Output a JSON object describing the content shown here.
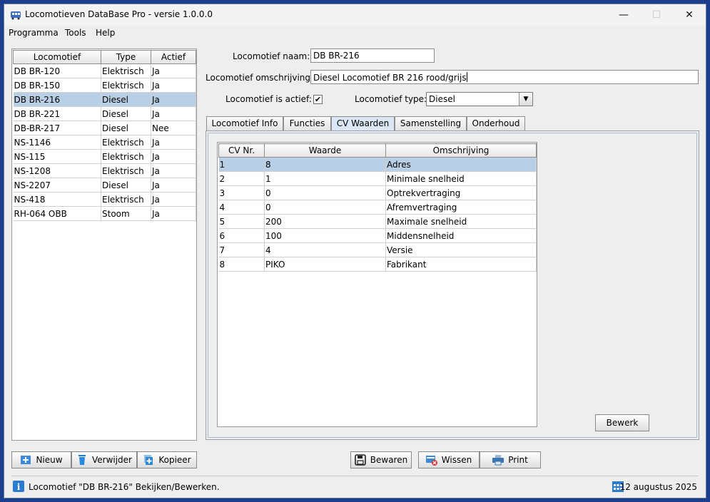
{
  "window": {
    "title": "Locomotieven DataBase Pro - versie 1.0.0.0",
    "minimize_glyph": "—",
    "maximize_glyph": "☐",
    "close_glyph": "✕"
  },
  "menu": [
    "Programma",
    "Tools",
    "Help"
  ],
  "loco_list": {
    "headers": [
      "Locomotief",
      "Type",
      "Actief"
    ],
    "rows": [
      [
        "DB BR-120",
        "Elektrisch",
        "Ja"
      ],
      [
        "DB BR-150",
        "Elektrisch",
        "Ja"
      ],
      [
        "DB BR-216",
        "Diesel",
        "Ja"
      ],
      [
        "DB BR-221",
        "Diesel",
        "Ja"
      ],
      [
        "DB-BR-217",
        "Diesel",
        "Nee"
      ],
      [
        "NS-1146",
        "Elektrisch",
        "Ja"
      ],
      [
        "NS-115",
        "Elektrisch",
        "Ja"
      ],
      [
        "NS-1208",
        "Elektrisch",
        "Ja"
      ],
      [
        "NS-2207",
        "Diesel",
        "Ja"
      ],
      [
        "NS-418",
        "Elektrisch",
        "Ja"
      ],
      [
        "RH-064 OBB",
        "Stoom",
        "Ja"
      ]
    ],
    "selected_index": 2
  },
  "form": {
    "naam_label": "Locomotief naam:",
    "naam_value": "DB BR-216",
    "omschrijving_label": "Locomotief omschrijving:",
    "omschrijving_value": "Diesel Locomotief BR 216 rood/grijs",
    "actief_label": "Locomotief is actief:",
    "actief_checked": true,
    "actief_mark": "✔",
    "type_label": "Locomotief type:",
    "type_value": "Diesel",
    "type_arrow": "▼"
  },
  "tabs": [
    "Locomotief Info",
    "Functies",
    "CV Waarden",
    "Samenstelling",
    "Onderhoud"
  ],
  "active_tab": 2,
  "cv_table": {
    "headers": [
      "CV Nr.",
      "Waarde",
      "Omschrijving"
    ],
    "rows": [
      [
        "1",
        "8",
        "Adres"
      ],
      [
        "2",
        "1",
        "Minimale snelheid"
      ],
      [
        "3",
        "0",
        "Optrekvertraging"
      ],
      [
        "4",
        "0",
        "Afremvertraging"
      ],
      [
        "5",
        "200",
        "Maximale snelheid"
      ],
      [
        "6",
        "100",
        "Middensnelheid"
      ],
      [
        "7",
        "4",
        "Versie"
      ],
      [
        "8",
        "PIKO",
        "Fabrikant"
      ]
    ],
    "selected_index": 0
  },
  "buttons": {
    "bewerk": "Bewerk",
    "nieuw": "Nieuw",
    "verwijder": "Verwijder",
    "kopieer": "Kopieer",
    "bewaren": "Bewaren",
    "wissen": "Wissen",
    "print": "Print"
  },
  "status": {
    "info_glyph": "i",
    "message": "Locomotief \"DB BR-216\" Bekijken/Bewerken.",
    "date": "12 augustus 2025"
  },
  "colors": {
    "selection": "#b8cfe5",
    "window_bg": "#eeeeee",
    "accent": "#2b7bd0"
  }
}
